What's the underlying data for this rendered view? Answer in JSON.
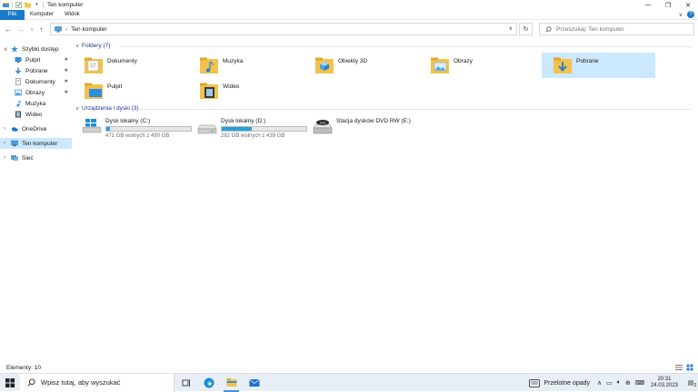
{
  "window": {
    "title": "Ten komputer",
    "controls": {
      "minimize": "—",
      "maximize": "❐",
      "close": "✕"
    }
  },
  "ribbon": {
    "tabs": [
      {
        "label": "Plik"
      },
      {
        "label": "Komputer"
      },
      {
        "label": "Widok"
      }
    ],
    "expand_glyph": "∨",
    "help_glyph": "?"
  },
  "addressbar": {
    "back": "←",
    "forward": "→",
    "recent": "∨",
    "up": "↑",
    "path": "Ten komputer",
    "separator": "›",
    "refresh": "↻",
    "search_placeholder": "Przeszukaj: Ten komputer"
  },
  "navpane": {
    "items": [
      {
        "label": "Szybki dostęp",
        "icon": "star-icon",
        "chevron": "∨",
        "pinned": false
      },
      {
        "label": "Pulpit",
        "icon": "desktop-icon",
        "pinned": true
      },
      {
        "label": "Pobrane",
        "icon": "download-icon",
        "pinned": true
      },
      {
        "label": "Dokumenty",
        "icon": "documents-icon",
        "pinned": true
      },
      {
        "label": "Obrazy",
        "icon": "pictures-icon",
        "pinned": true
      },
      {
        "label": "Muzyka",
        "icon": "music-icon",
        "pinned": false
      },
      {
        "label": "Wideo",
        "icon": "video-icon",
        "pinned": false
      },
      {
        "label": "OneDrive",
        "icon": "onedrive-icon",
        "chevron": "›"
      },
      {
        "label": "Ten komputer",
        "icon": "computer-icon",
        "chevron": "›",
        "selected": true
      },
      {
        "label": "Sieć",
        "icon": "network-icon",
        "chevron": "›"
      }
    ],
    "pin_glyph": "📌"
  },
  "content": {
    "folders_header": "Foldery (7)",
    "folders": [
      {
        "label": "Dokumenty",
        "icon": "documents-folder-icon"
      },
      {
        "label": "Muzyka",
        "icon": "music-folder-icon"
      },
      {
        "label": "Obiekty 3D",
        "icon": "3d-objects-folder-icon"
      },
      {
        "label": "Obrazy",
        "icon": "pictures-folder-icon"
      },
      {
        "label": "Pobrane",
        "icon": "downloads-folder-icon",
        "selected": true
      },
      {
        "label": "Pulpit",
        "icon": "desktop-folder-icon"
      },
      {
        "label": "Wideo",
        "icon": "videos-folder-icon"
      }
    ],
    "drives_header": "Urządzenia i dyski (3)",
    "drives": [
      {
        "label": "Dysk lokalny (C:)",
        "free_text": "471 GB wolnych z 490 GB",
        "used_fraction": 0.04,
        "icon": "windows-drive-icon"
      },
      {
        "label": "Dysk lokalny (D:)",
        "free_text": "282 GB wolnych z 439 GB",
        "used_fraction": 0.36,
        "icon": "hard-drive-icon"
      },
      {
        "label": "Stacja dysków DVD RW (E:)",
        "icon": "dvd-drive-icon"
      }
    ]
  },
  "statusbar": {
    "item_count": "Elementy: 10"
  },
  "taskbar": {
    "search_placeholder": "Wpisz tutaj, aby wyszukać",
    "weather": "Przelotne opady",
    "time": "20:31",
    "date": "24.03.2023",
    "notification_count": "3",
    "colors": {
      "accent": "#1979ca",
      "selection": "#cce8ff",
      "drive_fill": "#26a0da"
    }
  }
}
